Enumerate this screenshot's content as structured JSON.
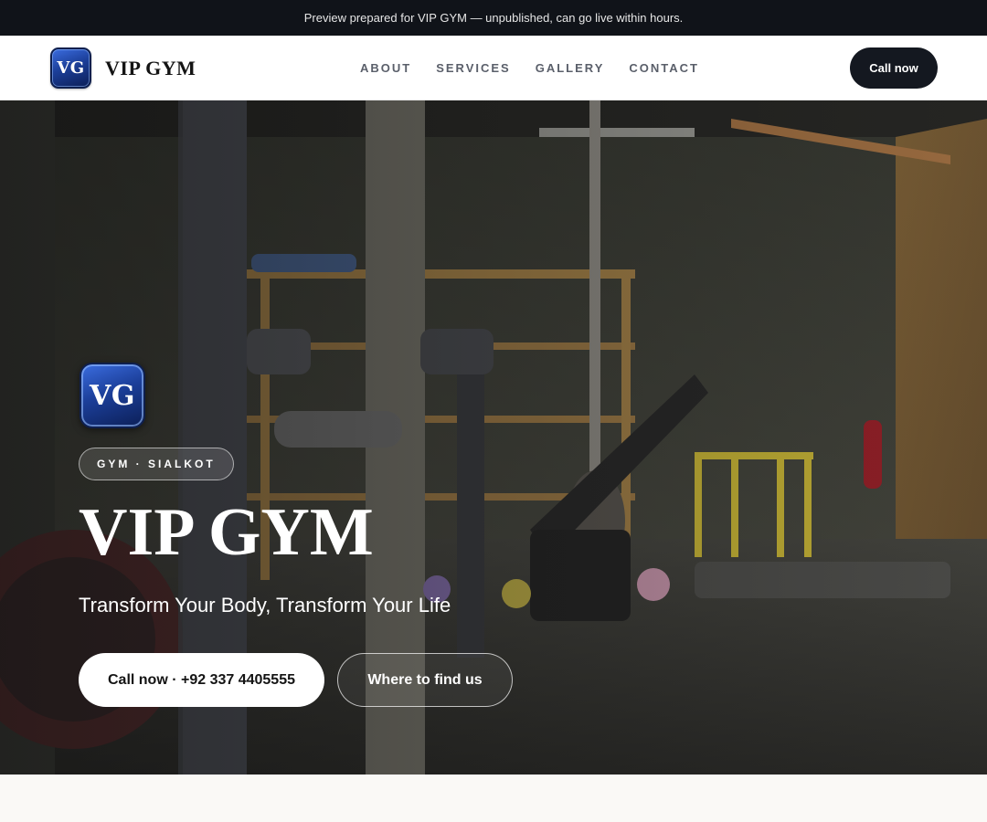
{
  "preview_bar": {
    "text": "Preview prepared for VIP GYM — unpublished, can go live within hours."
  },
  "nav": {
    "logo_initials": "VG",
    "brand_name": "VIP GYM",
    "links": [
      {
        "label": "ABOUT"
      },
      {
        "label": "SERVICES"
      },
      {
        "label": "GALLERY"
      },
      {
        "label": "CONTACT"
      }
    ],
    "cta_label": "Call now"
  },
  "hero": {
    "logo_initials": "VG",
    "tag": "GYM · SIALKOT",
    "title": "VIP GYM",
    "subtitle": "Transform Your Body, Transform Your Life",
    "primary_button": "Call now · +92 337 4405555",
    "secondary_button": "Where to find us"
  },
  "colors": {
    "dark": "#101319",
    "logo_blue": "#1c3f9a",
    "nav_text": "#5a5f6a",
    "page_bg": "#faf9f6"
  }
}
